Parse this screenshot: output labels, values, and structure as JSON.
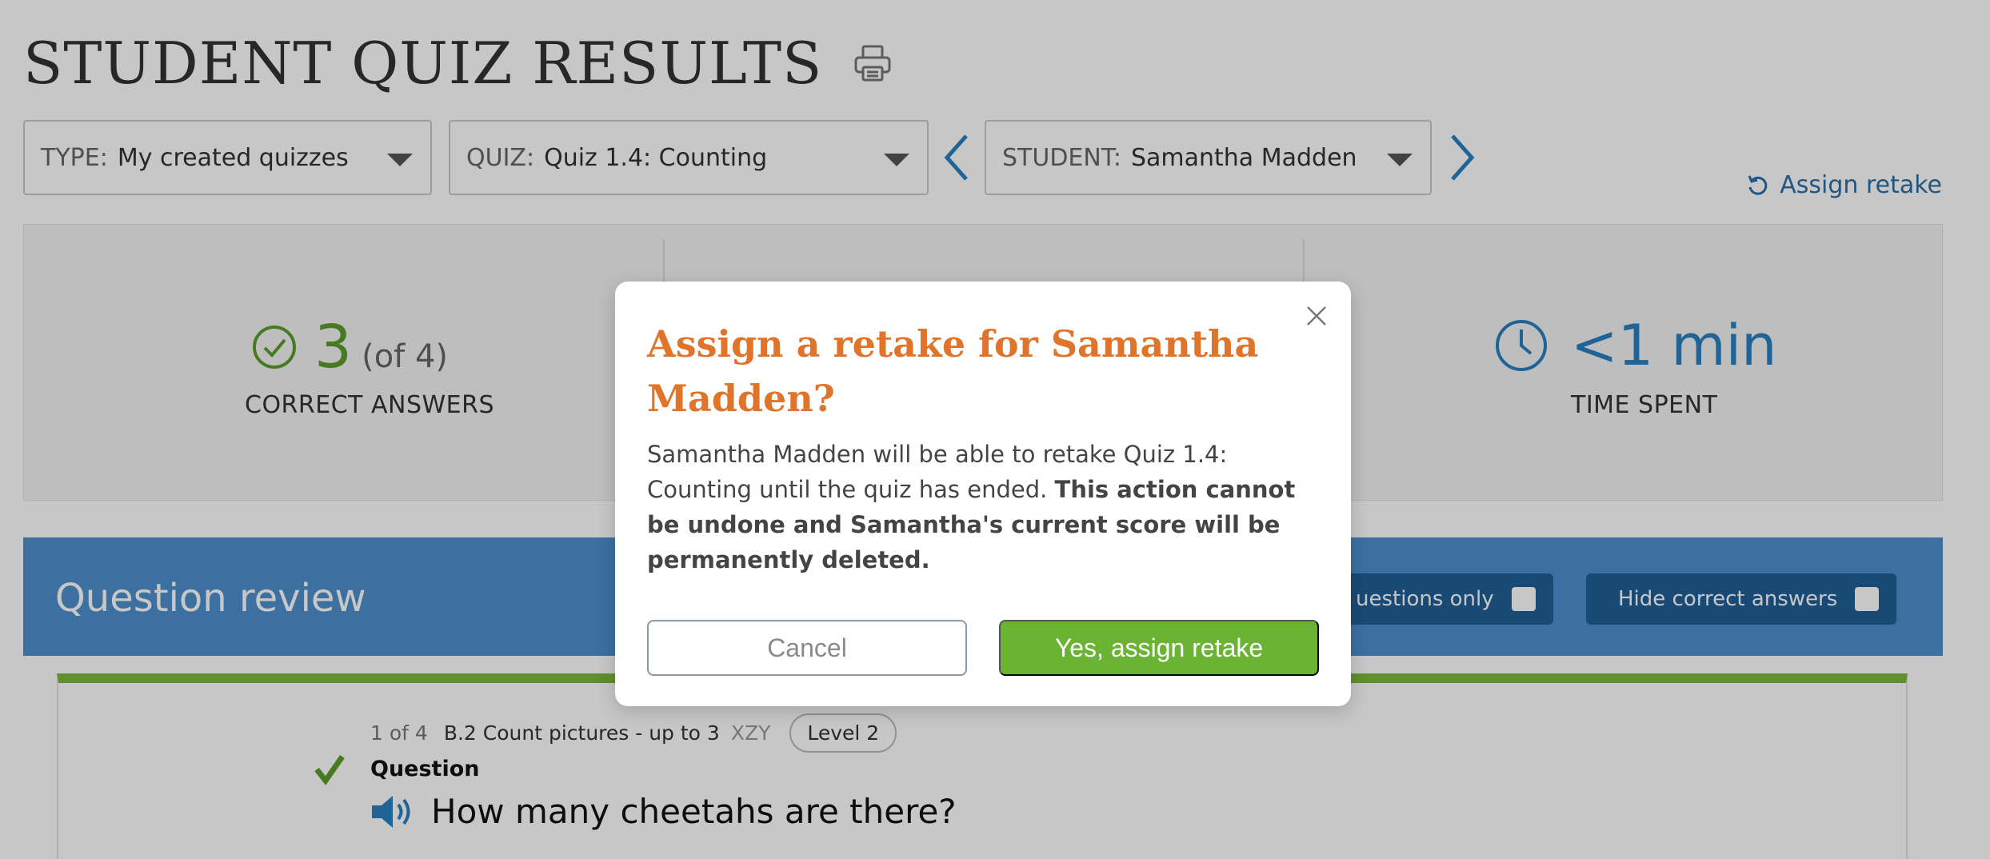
{
  "page": {
    "title": "STUDENT QUIZ RESULTS",
    "print_icon": "printer-icon"
  },
  "filters": {
    "type": {
      "label": "TYPE:",
      "value": "My created quizzes"
    },
    "quiz": {
      "label": "QUIZ:",
      "value": "Quiz 1.4: Counting"
    },
    "student": {
      "label": "STUDENT:",
      "value": "Samantha Madden"
    }
  },
  "assign_retake_link": {
    "label": "Assign retake",
    "icon": "undo-arrow-icon"
  },
  "stats": {
    "correct": {
      "value": "3",
      "of": "(of 4)",
      "label": "CORRECT ANSWERS"
    },
    "time": {
      "value": "<1 min",
      "label": "TIME SPENT"
    }
  },
  "review": {
    "title": "Question review",
    "incorrect_only_label": "uestions only",
    "hide_correct_label": "Hide correct answers"
  },
  "question": {
    "number": "1 of 4",
    "skill": "B.2 Count pictures - up to 3",
    "code": "XZY",
    "level": "Level 2",
    "heading": "Question",
    "text": "How many cheetahs are there?"
  },
  "modal": {
    "title": "Assign a retake for Samantha Madden?",
    "body_plain": "Samantha Madden will be able to retake Quiz 1.4: Counting until the quiz has ended. ",
    "body_bold": "This action cannot be undone and Samantha's current score will be permanently deleted.",
    "cancel_label": "Cancel",
    "confirm_label": "Yes, assign retake"
  },
  "colors": {
    "modal_title": "#e0742a",
    "confirm_button": "#6bb433",
    "review_bar": "#4d90cf",
    "correct_green": "#5a9e2b",
    "time_blue": "#2a7fc0"
  }
}
